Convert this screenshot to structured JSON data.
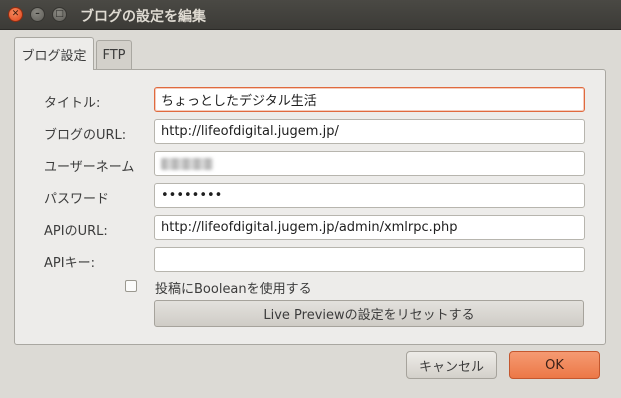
{
  "window": {
    "title": "ブログの設定を編集",
    "close_glyph": "✕",
    "minimize_glyph": "–",
    "maximize_glyph": "□"
  },
  "tabs": [
    {
      "label": "ブログ設定",
      "active": true
    },
    {
      "label": "FTP",
      "active": false
    }
  ],
  "form": {
    "title_label": "タイトル:",
    "title_value": "ちょっとしたデジタル生活",
    "url_label": "ブログのURL:",
    "url_value": "http://lifeofdigital.jugem.jp/",
    "username_label": "ユーザーネーム",
    "username_value": "",
    "password_label": "パスワード",
    "password_value": "••••••••",
    "api_url_label": "APIのURL:",
    "api_url_value": "http://lifeofdigital.jugem.jp/admin/xmlrpc.php",
    "api_key_label": "APIキー:",
    "api_key_value": "",
    "boolean_checkbox_label": "投稿にBooleanを使用する",
    "boolean_checked": false,
    "reset_button_label": "Live Previewの設定をリセットする"
  },
  "buttons": {
    "cancel_label": "キャンセル",
    "ok_label": "OK"
  },
  "colors": {
    "accent": "#ec7847",
    "titlebar": "#3c3b37",
    "window_bg": "#dcdad5"
  }
}
